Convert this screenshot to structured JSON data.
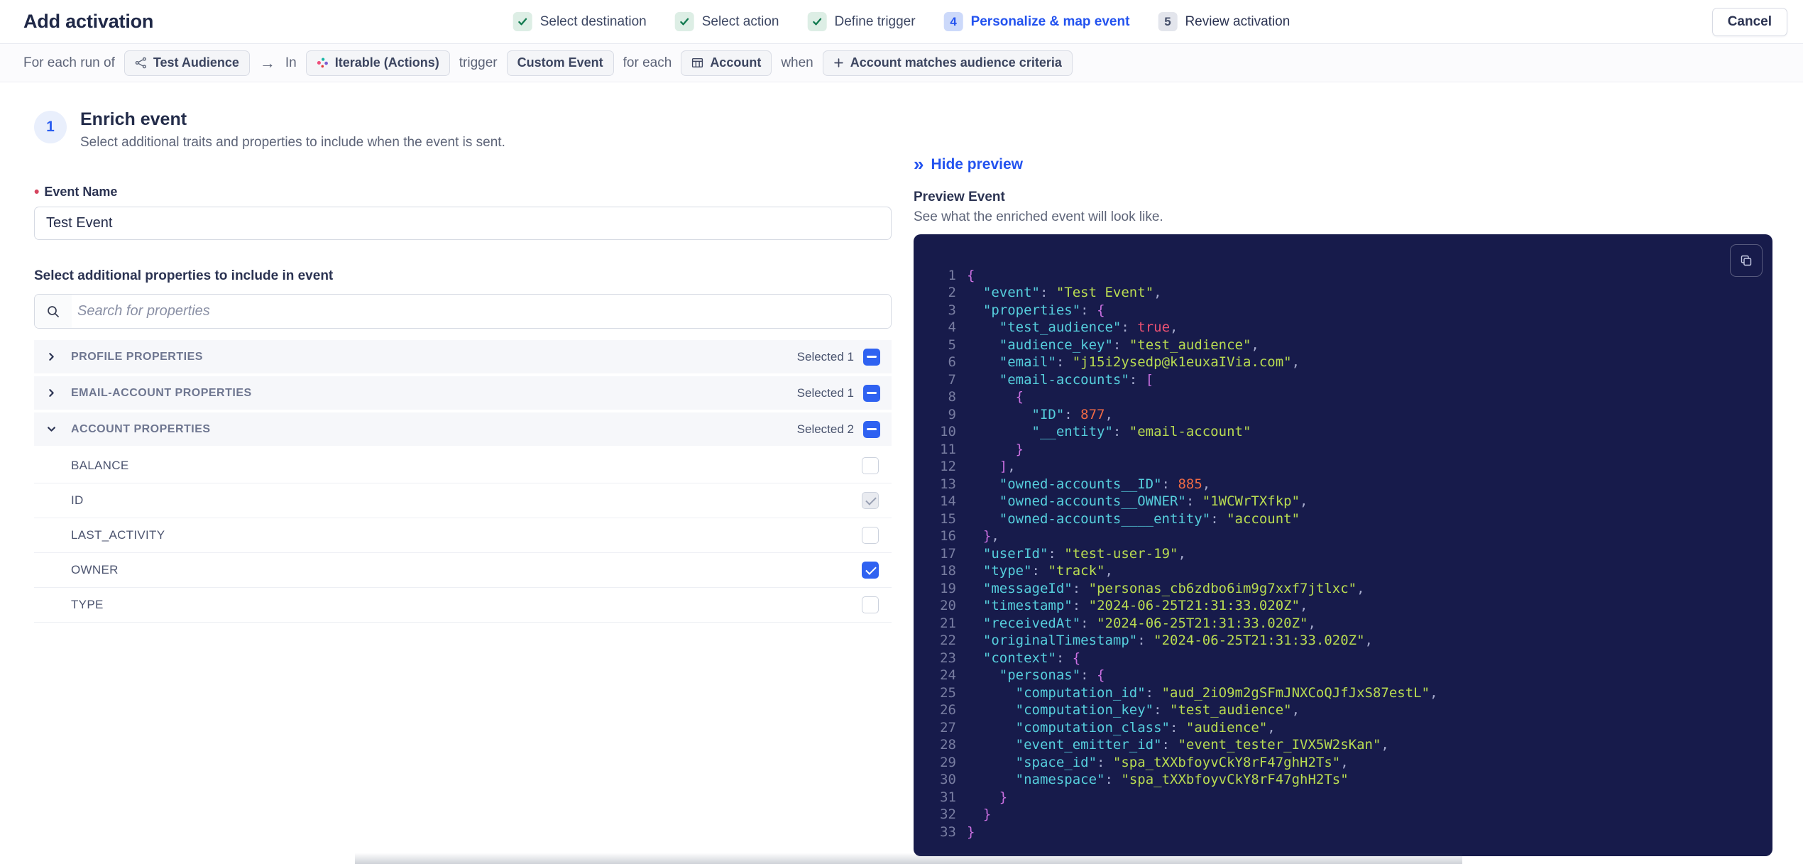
{
  "header": {
    "title": "Add activation",
    "cancel_label": "Cancel",
    "steps": [
      {
        "label": "Select destination",
        "state": "done"
      },
      {
        "label": "Select action",
        "state": "done"
      },
      {
        "label": "Define trigger",
        "state": "done"
      },
      {
        "label": "Personalize & map event",
        "state": "active",
        "number": "4"
      },
      {
        "label": "Review activation",
        "state": "upcoming",
        "number": "5"
      }
    ]
  },
  "trigger_bar": {
    "segments": [
      {
        "type": "text",
        "text": "For each run of"
      },
      {
        "type": "chip",
        "icon": "audience-icon",
        "label": "Test Audience"
      },
      {
        "type": "arrow",
        "text": "→"
      },
      {
        "type": "text",
        "text": "In"
      },
      {
        "type": "chip",
        "icon": "iterable-icon",
        "label": "Iterable (Actions)"
      },
      {
        "type": "text",
        "text": "trigger"
      },
      {
        "type": "chip",
        "label": "Custom Event"
      },
      {
        "type": "text",
        "text": "for each"
      },
      {
        "type": "chip",
        "icon": "table-icon",
        "label": "Account"
      },
      {
        "type": "text",
        "text": "when"
      },
      {
        "type": "chip",
        "icon": "plus-icon",
        "label": "Account matches audience criteria"
      }
    ]
  },
  "enrich": {
    "step_number": "1",
    "title": "Enrich event",
    "subtitle": "Select additional traits and properties to include when the event is sent.",
    "required_marker": "•",
    "event_name_label": "Event Name",
    "event_name_value": "Test Event",
    "properties_label": "Select additional properties to include in event",
    "search_placeholder": "Search for properties",
    "groups": [
      {
        "label": "PROFILE PROPERTIES",
        "selected_text": "Selected 1",
        "expanded": false,
        "properties": []
      },
      {
        "label": "EMAIL-ACCOUNT PROPERTIES",
        "selected_text": "Selected 1",
        "expanded": false,
        "properties": []
      },
      {
        "label": "ACCOUNT PROPERTIES",
        "selected_text": "Selected 2",
        "expanded": true,
        "properties": [
          {
            "label": "BALANCE",
            "state": "unchecked"
          },
          {
            "label": "ID",
            "state": "checked-disabled"
          },
          {
            "label": "LAST_ACTIVITY",
            "state": "unchecked"
          },
          {
            "label": "OWNER",
            "state": "checked"
          },
          {
            "label": "TYPE",
            "state": "unchecked"
          }
        ]
      }
    ]
  },
  "preview": {
    "hide_icon": "»",
    "hide_label": "Hide preview",
    "title": "Preview Event",
    "subtitle": "See what the enriched event will look like.",
    "code_lines": [
      [
        [
          "br",
          "{"
        ]
      ],
      [
        [
          "w",
          "  "
        ],
        [
          "k",
          "\"event\""
        ],
        [
          "pu",
          ": "
        ],
        [
          "s",
          "\"Test Event\""
        ],
        [
          "pu",
          ","
        ]
      ],
      [
        [
          "w",
          "  "
        ],
        [
          "k",
          "\"properties\""
        ],
        [
          "pu",
          ": "
        ],
        [
          "br",
          "{"
        ]
      ],
      [
        [
          "w",
          "    "
        ],
        [
          "k",
          "\"test_audience\""
        ],
        [
          "pu",
          ": "
        ],
        [
          "b",
          "true"
        ],
        [
          "pu",
          ","
        ]
      ],
      [
        [
          "w",
          "    "
        ],
        [
          "k",
          "\"audience_key\""
        ],
        [
          "pu",
          ": "
        ],
        [
          "s",
          "\"test_audience\""
        ],
        [
          "pu",
          ","
        ]
      ],
      [
        [
          "w",
          "    "
        ],
        [
          "k",
          "\"email\""
        ],
        [
          "pu",
          ": "
        ],
        [
          "s",
          "\"j15i2ysedp@k1euxaIVia.com\""
        ],
        [
          "pu",
          ","
        ]
      ],
      [
        [
          "w",
          "    "
        ],
        [
          "k",
          "\"email-accounts\""
        ],
        [
          "pu",
          ": "
        ],
        [
          "br",
          "["
        ]
      ],
      [
        [
          "w",
          "      "
        ],
        [
          "br",
          "{"
        ]
      ],
      [
        [
          "w",
          "        "
        ],
        [
          "k",
          "\"ID\""
        ],
        [
          "pu",
          ": "
        ],
        [
          "n",
          "877"
        ],
        [
          "pu",
          ","
        ]
      ],
      [
        [
          "w",
          "        "
        ],
        [
          "k",
          "\"__entity\""
        ],
        [
          "pu",
          ": "
        ],
        [
          "s",
          "\"email-account\""
        ]
      ],
      [
        [
          "w",
          "      "
        ],
        [
          "br",
          "}"
        ]
      ],
      [
        [
          "w",
          "    "
        ],
        [
          "br",
          "]"
        ],
        [
          "pu",
          ","
        ]
      ],
      [
        [
          "w",
          "    "
        ],
        [
          "k",
          "\"owned-accounts__ID\""
        ],
        [
          "pu",
          ": "
        ],
        [
          "n",
          "885"
        ],
        [
          "pu",
          ","
        ]
      ],
      [
        [
          "w",
          "    "
        ],
        [
          "k",
          "\"owned-accounts__OWNER\""
        ],
        [
          "pu",
          ": "
        ],
        [
          "s",
          "\"1WCWrTXfkp\""
        ],
        [
          "pu",
          ","
        ]
      ],
      [
        [
          "w",
          "    "
        ],
        [
          "k",
          "\"owned-accounts____entity\""
        ],
        [
          "pu",
          ": "
        ],
        [
          "s",
          "\"account\""
        ]
      ],
      [
        [
          "w",
          "  "
        ],
        [
          "br",
          "}"
        ],
        [
          "pu",
          ","
        ]
      ],
      [
        [
          "w",
          "  "
        ],
        [
          "k",
          "\"userId\""
        ],
        [
          "pu",
          ": "
        ],
        [
          "s",
          "\"test-user-19\""
        ],
        [
          "pu",
          ","
        ]
      ],
      [
        [
          "w",
          "  "
        ],
        [
          "k",
          "\"type\""
        ],
        [
          "pu",
          ": "
        ],
        [
          "s",
          "\"track\""
        ],
        [
          "pu",
          ","
        ]
      ],
      [
        [
          "w",
          "  "
        ],
        [
          "k",
          "\"messageId\""
        ],
        [
          "pu",
          ": "
        ],
        [
          "s",
          "\"personas_cb6zdbo6im9g7xxf7jtlxc\""
        ],
        [
          "pu",
          ","
        ]
      ],
      [
        [
          "w",
          "  "
        ],
        [
          "k",
          "\"timestamp\""
        ],
        [
          "pu",
          ": "
        ],
        [
          "s",
          "\"2024-06-25T21:31:33.020Z\""
        ],
        [
          "pu",
          ","
        ]
      ],
      [
        [
          "w",
          "  "
        ],
        [
          "k",
          "\"receivedAt\""
        ],
        [
          "pu",
          ": "
        ],
        [
          "s",
          "\"2024-06-25T21:31:33.020Z\""
        ],
        [
          "pu",
          ","
        ]
      ],
      [
        [
          "w",
          "  "
        ],
        [
          "k",
          "\"originalTimestamp\""
        ],
        [
          "pu",
          ": "
        ],
        [
          "s",
          "\"2024-06-25T21:31:33.020Z\""
        ],
        [
          "pu",
          ","
        ]
      ],
      [
        [
          "w",
          "  "
        ],
        [
          "k",
          "\"context\""
        ],
        [
          "pu",
          ": "
        ],
        [
          "br",
          "{"
        ]
      ],
      [
        [
          "w",
          "    "
        ],
        [
          "k",
          "\"personas\""
        ],
        [
          "pu",
          ": "
        ],
        [
          "br",
          "{"
        ]
      ],
      [
        [
          "w",
          "      "
        ],
        [
          "k",
          "\"computation_id\""
        ],
        [
          "pu",
          ": "
        ],
        [
          "s",
          "\"aud_2iO9m2gSFmJNXCoQJfJxS87estL\""
        ],
        [
          "pu",
          ","
        ]
      ],
      [
        [
          "w",
          "      "
        ],
        [
          "k",
          "\"computation_key\""
        ],
        [
          "pu",
          ": "
        ],
        [
          "s",
          "\"test_audience\""
        ],
        [
          "pu",
          ","
        ]
      ],
      [
        [
          "w",
          "      "
        ],
        [
          "k",
          "\"computation_class\""
        ],
        [
          "pu",
          ": "
        ],
        [
          "s",
          "\"audience\""
        ],
        [
          "pu",
          ","
        ]
      ],
      [
        [
          "w",
          "      "
        ],
        [
          "k",
          "\"event_emitter_id\""
        ],
        [
          "pu",
          ": "
        ],
        [
          "s",
          "\"event_tester_IVX5W2sKan\""
        ],
        [
          "pu",
          ","
        ]
      ],
      [
        [
          "w",
          "      "
        ],
        [
          "k",
          "\"space_id\""
        ],
        [
          "pu",
          ": "
        ],
        [
          "s",
          "\"spa_tXXbfoyvCkY8rF47ghH2Ts\""
        ],
        [
          "pu",
          ","
        ]
      ],
      [
        [
          "w",
          "      "
        ],
        [
          "k",
          "\"namespace\""
        ],
        [
          "pu",
          ": "
        ],
        [
          "s",
          "\"spa_tXXbfoyvCkY8rF47ghH2Ts\""
        ]
      ],
      [
        [
          "w",
          "    "
        ],
        [
          "br",
          "}"
        ]
      ],
      [
        [
          "w",
          "  "
        ],
        [
          "br",
          "}"
        ]
      ],
      [
        [
          "br",
          "}"
        ]
      ]
    ]
  },
  "colors": {
    "accent_blue": "#2353ef",
    "checkbox_blue": "#2f62f1",
    "success_green": "#127a50",
    "code_bg": "#171b4b",
    "code_key": "#56cfdd",
    "code_string": "#b9dc51",
    "code_number": "#ef6a45",
    "code_boolean": "#ee5273",
    "code_brace": "#c96fe0"
  }
}
